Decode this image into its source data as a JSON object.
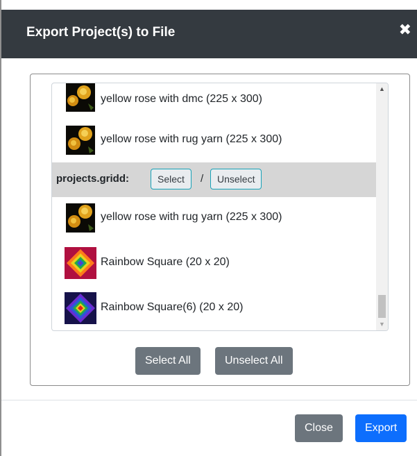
{
  "dialog": {
    "title": "Export Project(s) to File",
    "close_glyph": "✖"
  },
  "list": {
    "items_top": [
      {
        "label": "yellow rose with dmc (225 x 300)",
        "thumb": "yellow-rose-thumbnail"
      },
      {
        "label": "yellow rose with rug yarn (225 x 300)",
        "thumb": "yellow-rose-thumbnail"
      }
    ],
    "group": {
      "name": "projects.gridd:",
      "select_label": "Select",
      "separator": "/",
      "unselect_label": "Unselect"
    },
    "items_bottom": [
      {
        "label": "yellow rose with rug yarn (225 x 300)",
        "thumb": "yellow-rose-thumbnail"
      },
      {
        "label": "Rainbow Square (20 x 20)",
        "thumb": "rainbow-square-thumbnail"
      },
      {
        "label": "Rainbow Square(6) (20 x 20)",
        "thumb": "rainbow-square-6-thumbnail"
      }
    ]
  },
  "buttons": {
    "select_all": "Select All",
    "unselect_all": "Unselect All",
    "close": "Close",
    "export": "Export"
  },
  "colors": {
    "header_bg": "#343a40",
    "secondary": "#6c757d",
    "primary": "#0d6efd",
    "group_bg": "#d6d6d6",
    "outline_info": "#17a2b8"
  }
}
